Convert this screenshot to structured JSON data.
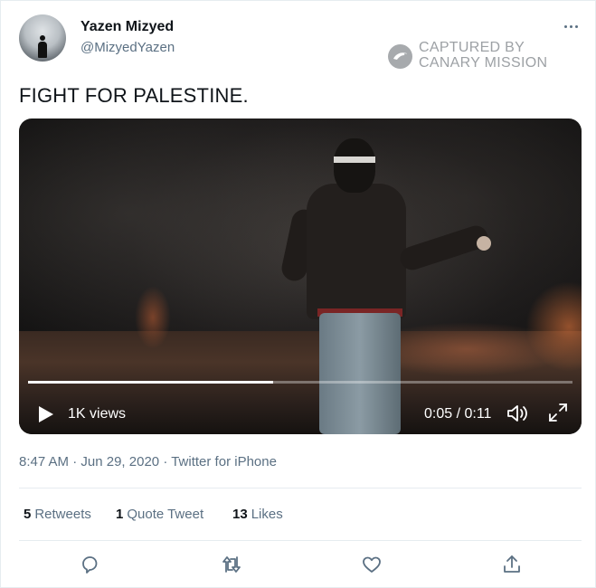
{
  "author": {
    "display_name": "Yazen Mizyed",
    "handle": "@MizyedYazen"
  },
  "watermark": {
    "line1": "CAPTURED BY",
    "line2": "CANARY MISSION"
  },
  "tweet": {
    "text": "FIGHT FOR PALESTINE."
  },
  "video": {
    "views": "1K views",
    "time": "0:05 / 0:11",
    "progress": 0.45
  },
  "meta": {
    "time": "8:47 AM",
    "date": "Jun 29, 2020",
    "source": "Twitter for iPhone",
    "separator": "·"
  },
  "stats": {
    "retweets_count": "5",
    "retweets_label": "Retweets",
    "quotes_count": "1",
    "quotes_label": "Quote Tweet",
    "likes_count": "13",
    "likes_label": "Likes"
  },
  "actions": [
    {
      "icon": "reply-icon"
    },
    {
      "icon": "retweet-icon"
    },
    {
      "icon": "like-icon"
    },
    {
      "icon": "share-icon"
    }
  ],
  "colors": {
    "secondary_text": "#5b7083",
    "primary_text": "#0f1419",
    "divider": "#e6ecf0"
  }
}
